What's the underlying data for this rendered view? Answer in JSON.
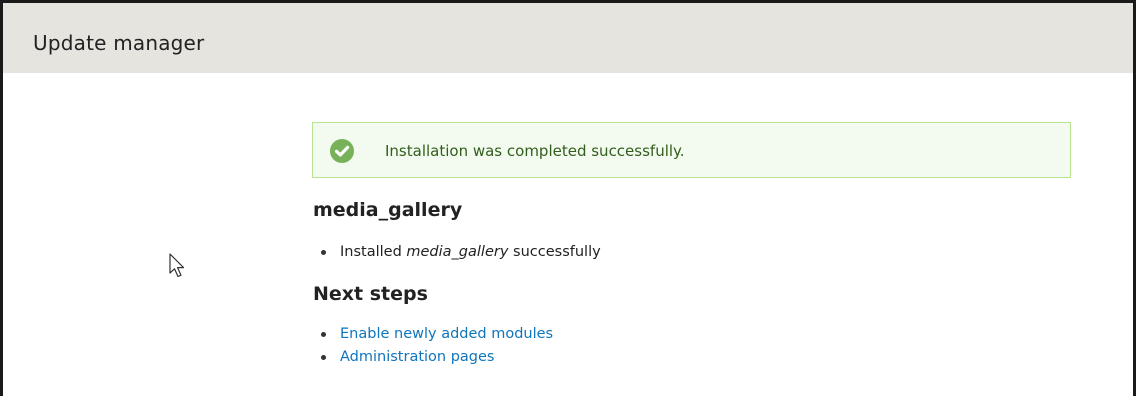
{
  "header": {
    "title": "Update manager"
  },
  "status_message": {
    "icon": "check-circle-icon",
    "text": "Installation was completed successfully.",
    "colors": {
      "border": "#b7e28e",
      "background": "#f3faef",
      "icon": "#77b259",
      "text": "#325e1c"
    }
  },
  "module": {
    "heading": "media_gallery",
    "result": {
      "prefix": "Installed",
      "module_name": "media_gallery",
      "suffix": "successfully"
    }
  },
  "next_steps": {
    "heading": "Next steps",
    "links": [
      {
        "label": "Enable newly added modules"
      },
      {
        "label": "Administration pages"
      }
    ]
  },
  "colors": {
    "header_background": "#e6e4df",
    "link": "#0f75bc"
  }
}
